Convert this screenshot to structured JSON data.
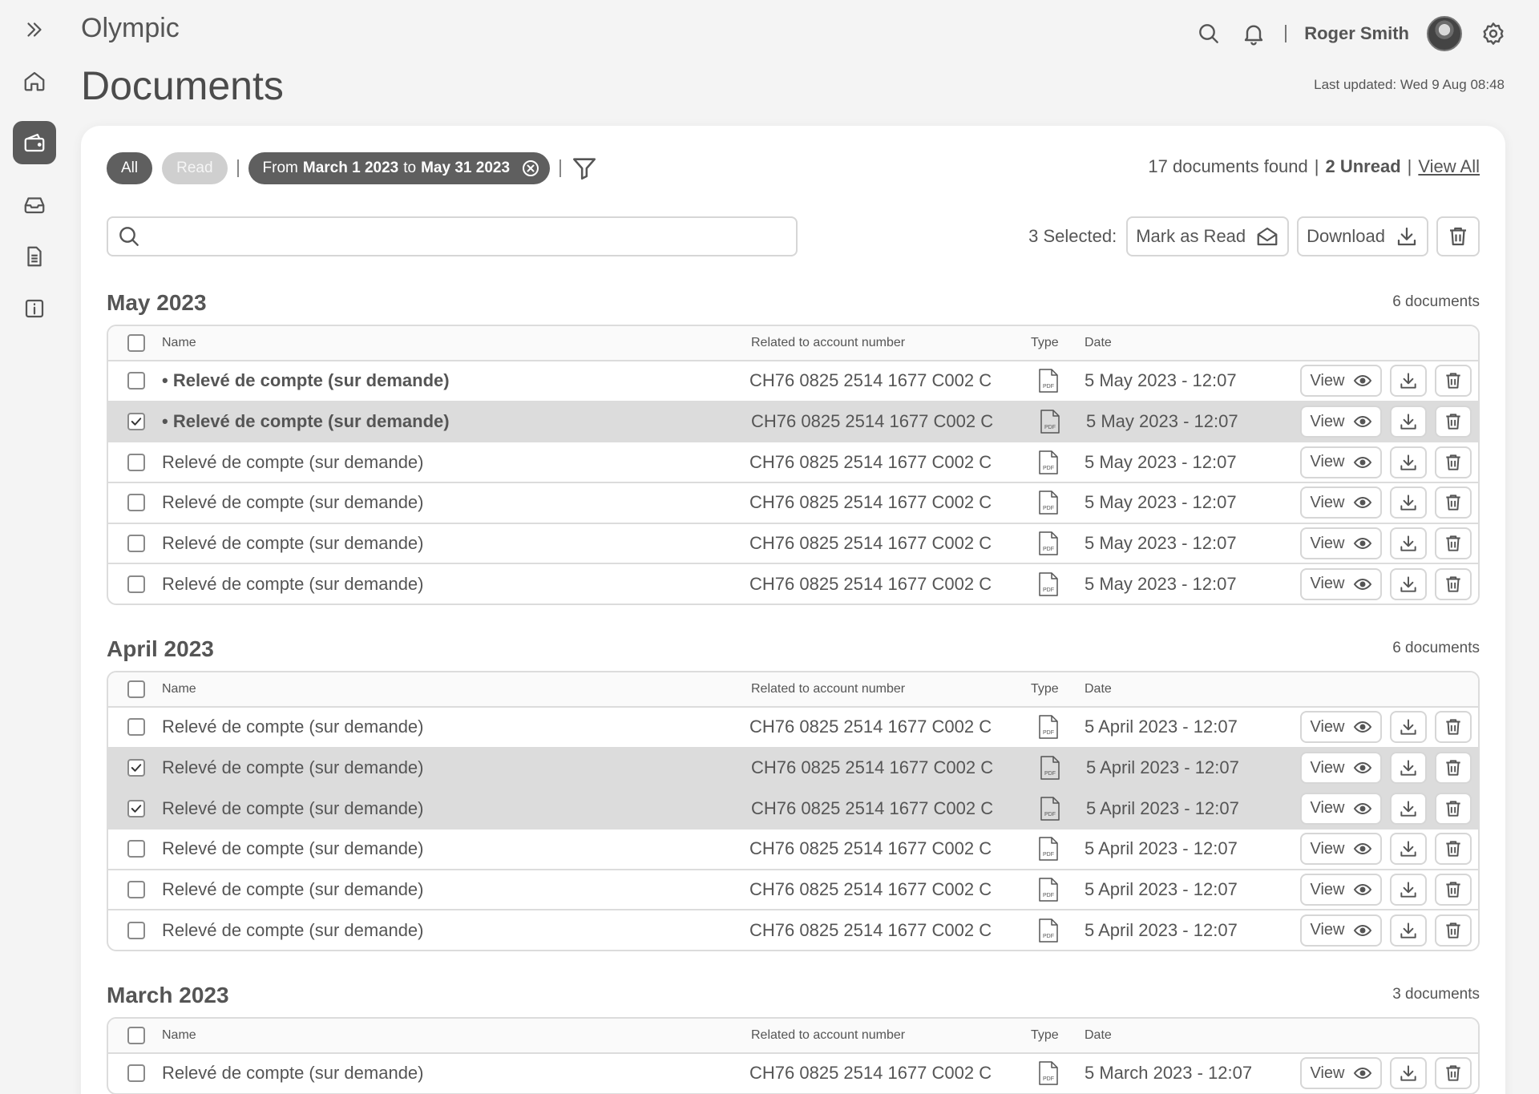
{
  "app": {
    "brand": "Olympic",
    "page_title": "Documents",
    "last_updated": "Last updated: Wed 9 Aug 08:48"
  },
  "header": {
    "user_name": "Roger Smith"
  },
  "sidebar": {
    "items": [
      {
        "name": "expand",
        "icon": "chevrons-right-icon"
      },
      {
        "name": "home",
        "icon": "home-icon"
      },
      {
        "name": "wallet",
        "icon": "wallet-icon",
        "active": true
      },
      {
        "name": "inbox",
        "icon": "inbox-icon"
      },
      {
        "name": "documents",
        "icon": "document-icon"
      },
      {
        "name": "info",
        "icon": "info-icon"
      }
    ]
  },
  "filters": {
    "all": "All",
    "read": "Read",
    "date_from_prefix": "From",
    "date_from": "March 1 2023",
    "date_to_prefix": "to",
    "date_to": "May 31 2023"
  },
  "summary": {
    "found": "17 documents found",
    "sep": "|",
    "unread": "2 Unread",
    "view_all": "View All"
  },
  "search": {
    "placeholder": ""
  },
  "bulk": {
    "selected": "3 Selected:",
    "mark_read": "Mark as Read",
    "download": "Download"
  },
  "table_headers": {
    "name": "Name",
    "account": "Related to account number",
    "type": "Type",
    "date": "Date"
  },
  "view_label": "View",
  "sections": [
    {
      "title": "May 2023",
      "count": "6 documents",
      "rows": [
        {
          "name": "• Relevé de compte (sur demande)",
          "account": "CH76 0825 2514 1677 C002 C",
          "date": "5 May 2023 - 12:07",
          "unread": true,
          "selected": false
        },
        {
          "name": "• Relevé de compte (sur demande)",
          "account": "CH76 0825 2514 1677 C002 C",
          "date": "5 May 2023 - 12:07",
          "unread": true,
          "selected": true
        },
        {
          "name": "Relevé de compte (sur demande)",
          "account": "CH76 0825 2514 1677 C002 C",
          "date": "5 May 2023 - 12:07",
          "unread": false,
          "selected": false
        },
        {
          "name": "Relevé de compte (sur demande)",
          "account": "CH76 0825 2514 1677 C002 C",
          "date": "5 May 2023 - 12:07",
          "unread": false,
          "selected": false
        },
        {
          "name": "Relevé de compte (sur demande)",
          "account": "CH76 0825 2514 1677 C002 C",
          "date": "5 May 2023 - 12:07",
          "unread": false,
          "selected": false
        },
        {
          "name": "Relevé de compte (sur demande)",
          "account": "CH76 0825 2514 1677 C002 C",
          "date": "5 May 2023 - 12:07",
          "unread": false,
          "selected": false
        }
      ]
    },
    {
      "title": "April 2023",
      "count": "6 documents",
      "rows": [
        {
          "name": "Relevé de compte (sur demande)",
          "account": "CH76 0825 2514 1677 C002 C",
          "date": "5 April 2023 - 12:07",
          "unread": false,
          "selected": false
        },
        {
          "name": "Relevé de compte (sur demande)",
          "account": "CH76 0825 2514 1677 C002 C",
          "date": "5 April 2023 - 12:07",
          "unread": false,
          "selected": true
        },
        {
          "name": "Relevé de compte (sur demande)",
          "account": "CH76 0825 2514 1677 C002 C",
          "date": "5 April 2023 - 12:07",
          "unread": false,
          "selected": true
        },
        {
          "name": "Relevé de compte (sur demande)",
          "account": "CH76 0825 2514 1677 C002 C",
          "date": "5 April 2023 - 12:07",
          "unread": false,
          "selected": false
        },
        {
          "name": "Relevé de compte (sur demande)",
          "account": "CH76 0825 2514 1677 C002 C",
          "date": "5 April 2023 - 12:07",
          "unread": false,
          "selected": false
        },
        {
          "name": "Relevé de compte (sur demande)",
          "account": "CH76 0825 2514 1677 C002 C",
          "date": "5 April 2023 - 12:07",
          "unread": false,
          "selected": false
        }
      ]
    },
    {
      "title": "March 2023",
      "count": "3 documents",
      "rows": [
        {
          "name": "Relevé de compte (sur demande)",
          "account": "CH76 0825 2514 1677 C002 C",
          "date": "5 March 2023 - 12:07",
          "unread": false,
          "selected": false
        }
      ]
    }
  ],
  "colors": {
    "selected_row": "#dcdcdc",
    "chip_active": "#5f5f5f",
    "chip_inactive": "#cfcfcf",
    "border": "#dcdcdc"
  }
}
